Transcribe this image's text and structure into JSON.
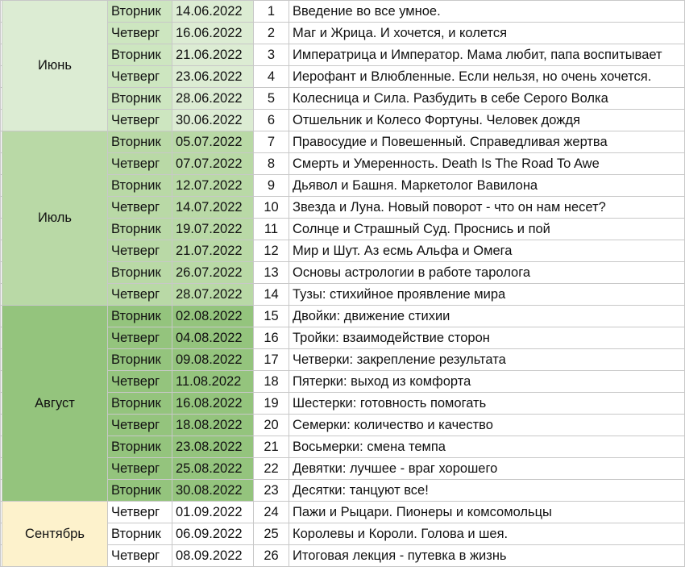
{
  "months": [
    {
      "name": "Июнь",
      "month_bg": "#dcecd3",
      "day_bg": "#cde6c0",
      "date_bg": "#dcecd3",
      "rows": [
        {
          "day": "Вторник",
          "date": "14.06.2022",
          "num": "1",
          "title": "Введение во все умное."
        },
        {
          "day": "Четверг",
          "date": "16.06.2022",
          "num": "2",
          "title": "Маг и Жрица. И хочется, и колется"
        },
        {
          "day": "Вторник",
          "date": "21.06.2022",
          "num": "3",
          "title": "Императрица и Император. Мама любит, папа воспитывает"
        },
        {
          "day": "Четверг",
          "date": "23.06.2022",
          "num": "4",
          "title": "Иерофант и Влюбленные. Если нельзя, но очень хочется."
        },
        {
          "day": "Вторник",
          "date": "28.06.2022",
          "num": "5",
          "title": "Колесница и Сила. Разбудить в себе Серого Волка"
        },
        {
          "day": "Четверг",
          "date": "30.06.2022",
          "num": "6",
          "title": "Отшельник и Колесо Фортуны. Человек дождя"
        }
      ]
    },
    {
      "name": "Июль",
      "month_bg": "#b9d9a6",
      "day_bg": "#b9d9a6",
      "date_bg": "#b9d9a6",
      "rows": [
        {
          "day": "Вторник",
          "date": "05.07.2022",
          "num": "7",
          "title": "Правосудие и Повешенный. Справедливая жертва"
        },
        {
          "day": "Четверг",
          "date": "07.07.2022",
          "num": "8",
          "title": "Смерть и Умеренность. Death Is The Road To Awe"
        },
        {
          "day": "Вторник",
          "date": "12.07.2022",
          "num": "9",
          "title": "Дьявол и Башня. Маркетолог Вавилона"
        },
        {
          "day": "Четверг",
          "date": "14.07.2022",
          "num": "10",
          "title": "Звезда и Луна. Новый поворот - что он нам несет?"
        },
        {
          "day": "Вторник",
          "date": "19.07.2022",
          "num": "11",
          "title": "Солнце и Страшный Суд. Проснись и пой"
        },
        {
          "day": "Четверг",
          "date": "21.07.2022",
          "num": "12",
          "title": "Мир и Шут. Аз есмь Альфа и Омега"
        },
        {
          "day": "Вторник",
          "date": "26.07.2022",
          "num": "13",
          "title": "Основы астрологии в работе таролога"
        },
        {
          "day": "Четверг",
          "date": "28.07.2022",
          "num": "14",
          "title": "Тузы: стихийное проявление мира"
        }
      ]
    },
    {
      "name": "Август",
      "month_bg": "#94c47d",
      "day_bg": "#94c47d",
      "date_bg": "#94c47d",
      "rows": [
        {
          "day": "Вторник",
          "date": "02.08.2022",
          "num": "15",
          "title": "Двойки: движение стихии"
        },
        {
          "day": "Четверг",
          "date": "04.08.2022",
          "num": "16",
          "title": "Тройки: взаимодействие сторон"
        },
        {
          "day": "Вторник",
          "date": "09.08.2022",
          "num": "17",
          "title": "Четверки: закрепление результата"
        },
        {
          "day": "Четверг",
          "date": "11.08.2022",
          "num": "18",
          "title": "Пятерки: выход из комфорта"
        },
        {
          "day": "Вторник",
          "date": "16.08.2022",
          "num": "19",
          "title": "Шестерки: готовность помогать"
        },
        {
          "day": "Четверг",
          "date": "18.08.2022",
          "num": "20",
          "title": "Семерки: количество и качество"
        },
        {
          "day": "Вторник",
          "date": "23.08.2022",
          "num": "21",
          "title": "Восьмерки: смена темпа"
        },
        {
          "day": "Четверг",
          "date": "25.08.2022",
          "num": "22",
          "title": "Девятки: лучшее - враг хорошего"
        },
        {
          "day": "Вторник",
          "date": "30.08.2022",
          "num": "23",
          "title": "Десятки: танцуют все!"
        }
      ]
    },
    {
      "name": "Сентябрь",
      "month_bg": "#fdf2cc",
      "day_bg": "#ffffff",
      "date_bg": "#ffffff",
      "rows": [
        {
          "day": "Четверг",
          "date": "01.09.2022",
          "num": "24",
          "title": "Пажи и Рыцари. Пионеры и комсомольцы"
        },
        {
          "day": "Вторник",
          "date": "06.09.2022",
          "num": "25",
          "title": "Королевы и Короли. Голова и шея."
        },
        {
          "day": "Четверг",
          "date": "08.09.2022",
          "num": "26",
          "title": "Итоговая лекция - путевка в жизнь"
        }
      ]
    }
  ]
}
